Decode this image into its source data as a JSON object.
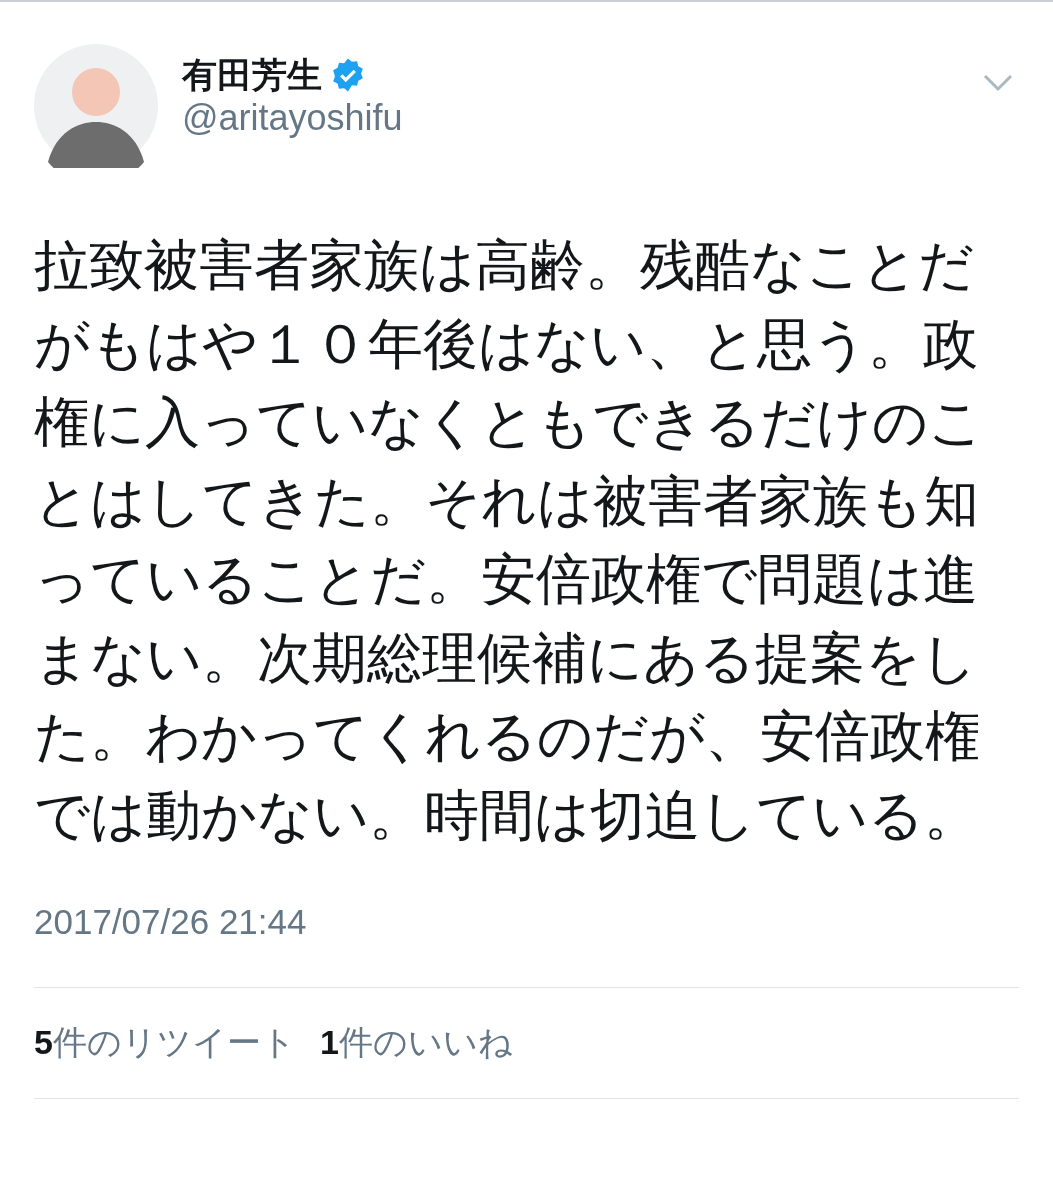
{
  "user": {
    "name": "有田芳生",
    "verified": true,
    "handle": "@aritayoshifu"
  },
  "tweet": {
    "text": "拉致被害者家族は高齢。残酷なことだがもはや１０年後はない、と思う。政権に入っていなくともできるだけのことはしてきた。それは被害者家族も知っていることだ。安倍政権で問題は進まない。次期総理候補にある提案をした。わかってくれるのだが、安倍政権では動かない。時間は切迫している。",
    "timestamp": "2017/07/26 21:44"
  },
  "stats": [
    {
      "text": "**5**件のリツイート"
    },
    {
      "text": "**1**件のいいね"
    }
  ]
}
